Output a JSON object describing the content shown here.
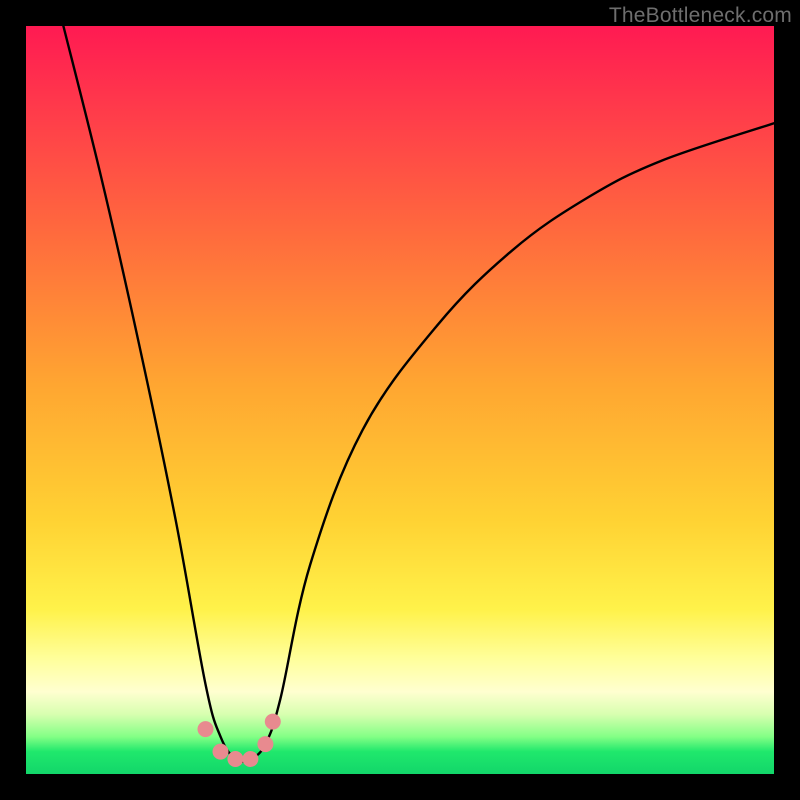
{
  "watermark": "TheBottleneck.com",
  "chart_data": {
    "type": "line",
    "title": "",
    "xlabel": "",
    "ylabel": "",
    "xlim": [
      0,
      100
    ],
    "ylim": [
      0,
      100
    ],
    "grid": false,
    "legend": false,
    "series": [
      {
        "name": "bottleneck-curve",
        "x": [
          5,
          10,
          15,
          20,
          24,
          26,
          28,
          30,
          32,
          34,
          38,
          45,
          55,
          65,
          75,
          85,
          100
        ],
        "y": [
          100,
          80,
          58,
          34,
          12,
          5,
          2,
          2,
          4,
          10,
          28,
          46,
          60,
          70,
          77,
          82,
          87
        ]
      }
    ],
    "markers": {
      "name": "bottom-cluster",
      "points": [
        {
          "x": 24,
          "y": 6
        },
        {
          "x": 26,
          "y": 3
        },
        {
          "x": 28,
          "y": 2
        },
        {
          "x": 30,
          "y": 2
        },
        {
          "x": 32,
          "y": 4
        },
        {
          "x": 33,
          "y": 7
        }
      ],
      "color": "#e88a8f",
      "radius_px": 8
    },
    "background_gradient": {
      "stops": [
        {
          "pos": 0.0,
          "color": "#ff1a52"
        },
        {
          "pos": 0.5,
          "color": "#ffb733"
        },
        {
          "pos": 0.85,
          "color": "#ffffc0"
        },
        {
          "pos": 0.97,
          "color": "#20e86c"
        },
        {
          "pos": 1.0,
          "color": "#12d66a"
        }
      ]
    }
  }
}
